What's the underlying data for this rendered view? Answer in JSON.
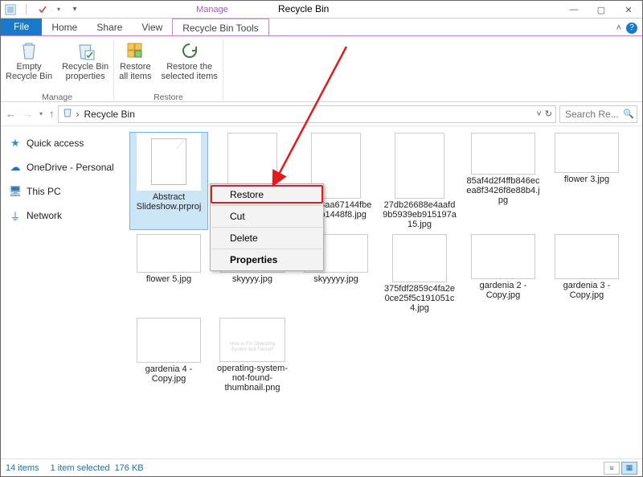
{
  "window": {
    "title": "Recycle Bin",
    "manage_label": "Manage"
  },
  "win_controls": {
    "min": "—",
    "max": "▢",
    "close": "✕"
  },
  "tabs": {
    "file": "File",
    "home": "Home",
    "share": "Share",
    "view": "View",
    "tools": "Recycle Bin Tools"
  },
  "ribbon": {
    "manage_group": "Manage",
    "restore_group": "Restore",
    "empty": "Empty\nRecycle Bin",
    "properties": "Recycle Bin\nproperties",
    "restore_all": "Restore\nall items",
    "restore_selected": "Restore the\nselected items"
  },
  "nav": {
    "back": "←",
    "forward": "→",
    "up": "↑",
    "crumb_root": "Recycle Bin",
    "search_placeholder": "Search Re..."
  },
  "sidebar": {
    "items": [
      {
        "icon": "★",
        "label": "Quick access",
        "color": "#2f8fd4"
      },
      {
        "icon": "☁",
        "label": "OneDrive - Personal",
        "color": "#1e73c9"
      },
      {
        "icon": "🖥",
        "label": "This PC",
        "color": "#3d74a8"
      },
      {
        "icon": "⏚",
        "label": "Network",
        "color": "#3d74a8"
      }
    ]
  },
  "files": [
    {
      "name": "Abstract Slideshow.prproj",
      "thumb": "doc",
      "selected": true
    },
    {
      "name": "",
      "thumb": "photo-pink-tall wide"
    },
    {
      "name": "588d3aa67144fbe679b1448f8.jpg",
      "thumb": "photo-pink-wide"
    },
    {
      "name": "27db26688e4aafd9b5939eb915197a15.jpg",
      "thumb": "photo-pink-right"
    },
    {
      "name": "85af4d2f4ffb846ecea8f3426f8e88b4.jpg",
      "thumb": "photo-blue1"
    },
    {
      "name": "flower 3.jpg",
      "thumb": "photo-white1"
    },
    {
      "name": "flower 5.jpg",
      "thumb": "photo-blue-small"
    },
    {
      "name": "skyyyy.jpg",
      "thumb": "photo-sky"
    },
    {
      "name": "skyyyyy.jpg",
      "thumb": "photo-sky2"
    },
    {
      "name": "375fdf2859c4fa2e0ce25f5c191051c4.jpg",
      "thumb": "photo-city"
    },
    {
      "name": "gardenia 2 - Copy.jpg",
      "thumb": "photo-gardenia"
    },
    {
      "name": "gardenia 3 - Copy.jpg",
      "thumb": "photo-gardenia-side"
    },
    {
      "name": "gardenia 4 - Copy.jpg",
      "thumb": "photo-gardenia4"
    },
    {
      "name": "operating-system-not-found-thumbnail.png",
      "thumb": "photo-black"
    }
  ],
  "context_menu": {
    "restore": "Restore",
    "cut": "Cut",
    "delete": "Delete",
    "properties": "Properties"
  },
  "status": {
    "count": "14 items",
    "selected": "1 item selected",
    "size": "176 KB"
  }
}
